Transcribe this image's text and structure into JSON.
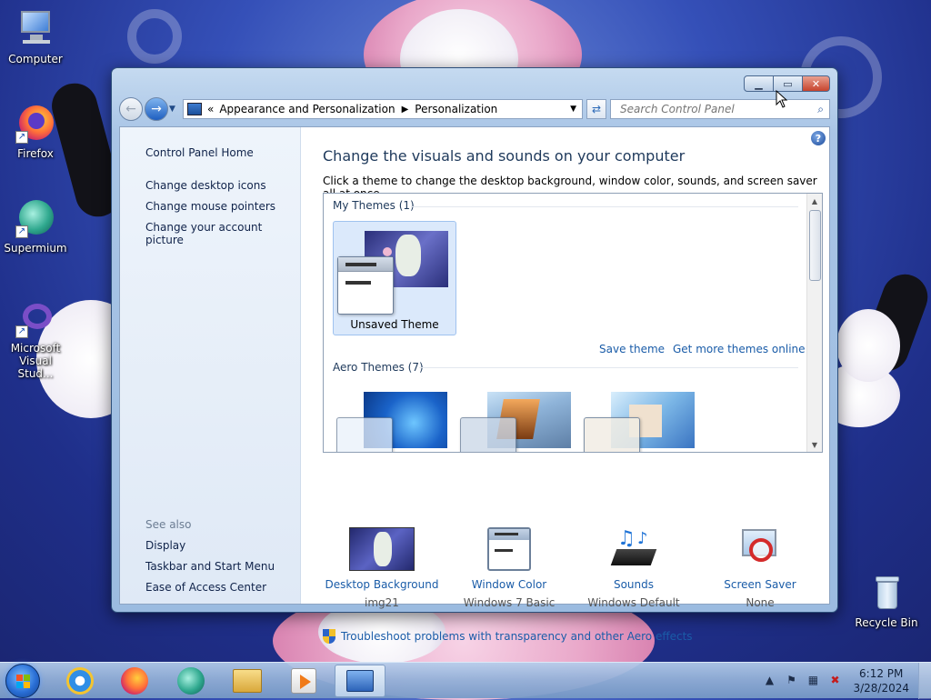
{
  "desktop": {
    "icons": [
      {
        "label": "Computer"
      },
      {
        "label": "Firefox"
      },
      {
        "label": "Supermium"
      },
      {
        "label": "Microsoft Visual Stud..."
      },
      {
        "label": "Recycle Bin"
      }
    ]
  },
  "window": {
    "nav": {
      "breadcrumb": [
        "Appearance and Personalization",
        "Personalization"
      ],
      "search_placeholder": "Search Control Panel"
    },
    "left": {
      "home": "Control Panel Home",
      "links": [
        "Change desktop icons",
        "Change mouse pointers",
        "Change your account picture"
      ],
      "see_also_title": "See also",
      "see_also": [
        "Display",
        "Taskbar and Start Menu",
        "Ease of Access Center"
      ]
    },
    "main": {
      "title": "Change the visuals and sounds on your computer",
      "description": "Click a theme to change the desktop background, window color, sounds, and screen saver all at once.",
      "my_themes_title": "My Themes (1)",
      "unsaved_theme": "Unsaved Theme",
      "save_theme": "Save theme",
      "get_more": "Get more themes online",
      "aero_title": "Aero Themes (7)",
      "items": [
        {
          "name": "Desktop Background",
          "value": "img21"
        },
        {
          "name": "Window Color",
          "value": "Windows 7 Basic"
        },
        {
          "name": "Sounds",
          "value": "Windows Default"
        },
        {
          "name": "Screen Saver",
          "value": "None"
        }
      ],
      "troubleshoot": "Troubleshoot problems with transparency and other Aero effects"
    }
  },
  "taskbar": {
    "time": "6:12 PM",
    "date": "3/28/2024"
  },
  "colors": {
    "link": "#1a5ca8",
    "title": "#1e395b",
    "selected_tile": "#dbe9fb"
  }
}
